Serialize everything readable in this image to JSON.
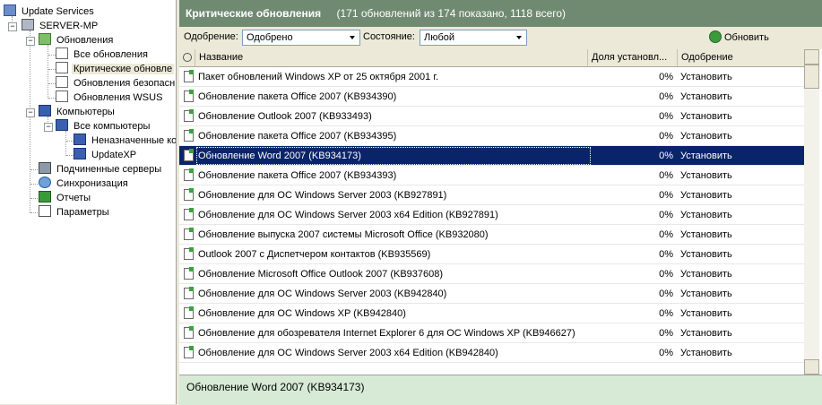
{
  "tree": {
    "root": "Update Services",
    "server": "SERVER-MP",
    "updates": "Обновления",
    "all_updates": "Все обновления",
    "critical_updates": "Критические обновле",
    "security_updates": "Обновления безопасн",
    "wsus_updates": "Обновления WSUS",
    "computers": "Компьютеры",
    "all_computers": "Все компьютеры",
    "unassigned": "Неназначенные ко",
    "updatexp": "UpdateXP",
    "downstream": "Подчиненные серверы",
    "sync": "Синхронизация",
    "reports": "Отчеты",
    "options": "Параметры"
  },
  "header": {
    "title": "Критические обновления",
    "count": "(171 обновлений из 174 показано, 1118 всего)"
  },
  "filters": {
    "approval_label": "Одобрение:",
    "approval_value": "Одобрено",
    "status_label": "Состояние:",
    "status_value": "Любой",
    "refresh_label": "Обновить"
  },
  "columns": {
    "name": "Название",
    "percent": "Доля установл...",
    "approval": "Одобрение"
  },
  "rows": [
    {
      "name": "Пакет обновлений Windows XP от 25 октября 2001 г.",
      "percent": "0%",
      "approval": "Установить"
    },
    {
      "name": "Обновление пакета Office 2007 (KB934390)",
      "percent": "0%",
      "approval": "Установить"
    },
    {
      "name": "Обновление Outlook 2007 (KB933493)",
      "percent": "0%",
      "approval": "Установить"
    },
    {
      "name": "Обновление пакета Office 2007 (KB934395)",
      "percent": "0%",
      "approval": "Установить"
    },
    {
      "name": "Обновление Word 2007 (KB934173)",
      "percent": "0%",
      "approval": "Установить"
    },
    {
      "name": "Обновление пакета Office 2007 (KB934393)",
      "percent": "0%",
      "approval": "Установить"
    },
    {
      "name": "Обновление для ОС Windows Server 2003 (KB927891)",
      "percent": "0%",
      "approval": "Установить"
    },
    {
      "name": "Обновление для ОС Windows Server 2003 x64 Edition (KB927891)",
      "percent": "0%",
      "approval": "Установить"
    },
    {
      "name": "Обновление выпуска 2007 системы Microsoft Office (KB932080)",
      "percent": "0%",
      "approval": "Установить"
    },
    {
      "name": "Outlook 2007 с Диспетчером контактов (KB935569)",
      "percent": "0%",
      "approval": "Установить"
    },
    {
      "name": "Обновление Microsoft Office Outlook 2007 (KB937608)",
      "percent": "0%",
      "approval": "Установить"
    },
    {
      "name": "Обновление для ОС Windows Server 2003 (KB942840)",
      "percent": "0%",
      "approval": "Установить"
    },
    {
      "name": "Обновление для ОС Windows XP (KB942840)",
      "percent": "0%",
      "approval": "Установить"
    },
    {
      "name": "Обновление для обозревателя Internet Explorer 6 для ОС Windows XP (KB946627)",
      "percent": "0%",
      "approval": "Установить"
    },
    {
      "name": "Обновление для ОС Windows Server 2003 x64 Edition (KB942840)",
      "percent": "0%",
      "approval": "Установить"
    }
  ],
  "selected_row": 4,
  "detail": {
    "title": "Обновление Word 2007 (KB934173)"
  },
  "colors": {
    "header_bg": "#6f8a71",
    "selection": "#0a246a",
    "detail_bg": "#d6ead6"
  }
}
